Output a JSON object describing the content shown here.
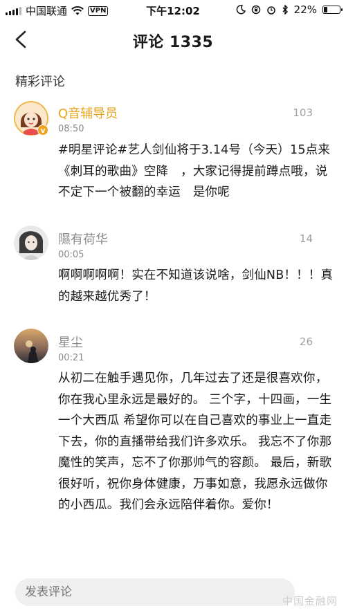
{
  "status_bar": {
    "carrier": "中国联通",
    "vpn": "VPN",
    "time": "下午12:02",
    "battery_percent": "22%",
    "battery_level": 0.22
  },
  "nav": {
    "title": "评论 1335"
  },
  "section_title": "精彩评论",
  "comments": [
    {
      "username": "Q音辅导员",
      "likes": "103",
      "time": "08:50",
      "content": "#明星评论#艺人剑仙将于3.14号（今天）15点来《刺耳的歌曲》空降　，大家记得提前蹲点哦，说不定下一个被翻的幸运　是你呢"
    },
    {
      "username": "隰有荷华",
      "likes": "14",
      "time": "00:05",
      "content": "啊啊啊啊啊！实在不知道该说啥，剑仙NB！！！真的越来越优秀了！"
    },
    {
      "username": "星尘",
      "likes": "26",
      "time": "00:21",
      "content": "从初二在触手遇见你，几年过去了还是很喜欢你，你在我心里永远是最好的。 三个字，十四画，一生一个大西瓜 希望你可以在自己喜欢的事业上一直走下去，你的直播带给我们许多欢乐。 我忘不了你那魔性的笑声，忘不了你那帅气的容颜。 最后，新歌很好听，祝你身体健康，万事如意，我愿永远做你的小西瓜。我们会永远陪伴着你。爱你！"
    }
  ],
  "input": {
    "placeholder": "发表评论"
  },
  "watermark": "中国金融网"
}
